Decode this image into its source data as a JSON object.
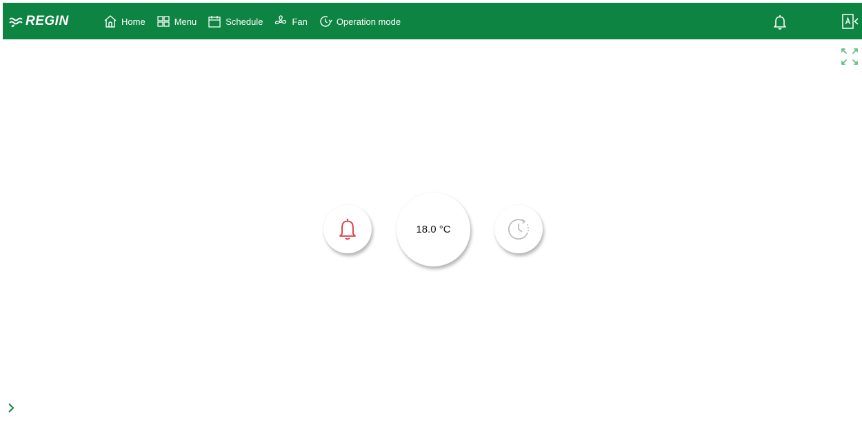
{
  "header": {
    "logo_text": "REGIN",
    "nav": {
      "home": "Home",
      "menu": "Menu",
      "schedule": "Schedule",
      "fan": "Fan",
      "operation_mode": "Operation mode"
    },
    "right_icons": [
      "bell-icon",
      "language-icon"
    ]
  },
  "main": {
    "temperature": "18.0 °C",
    "alarm_icon": "bell-icon",
    "schedule_icon": "clock-icon",
    "fullscreen_icon": "expand-icon",
    "expand_icon": "chevron-right-icon"
  },
  "colors": {
    "brand": "#0e8442",
    "alarm": "#d9373c",
    "muted_icon": "#bdbdbd"
  }
}
